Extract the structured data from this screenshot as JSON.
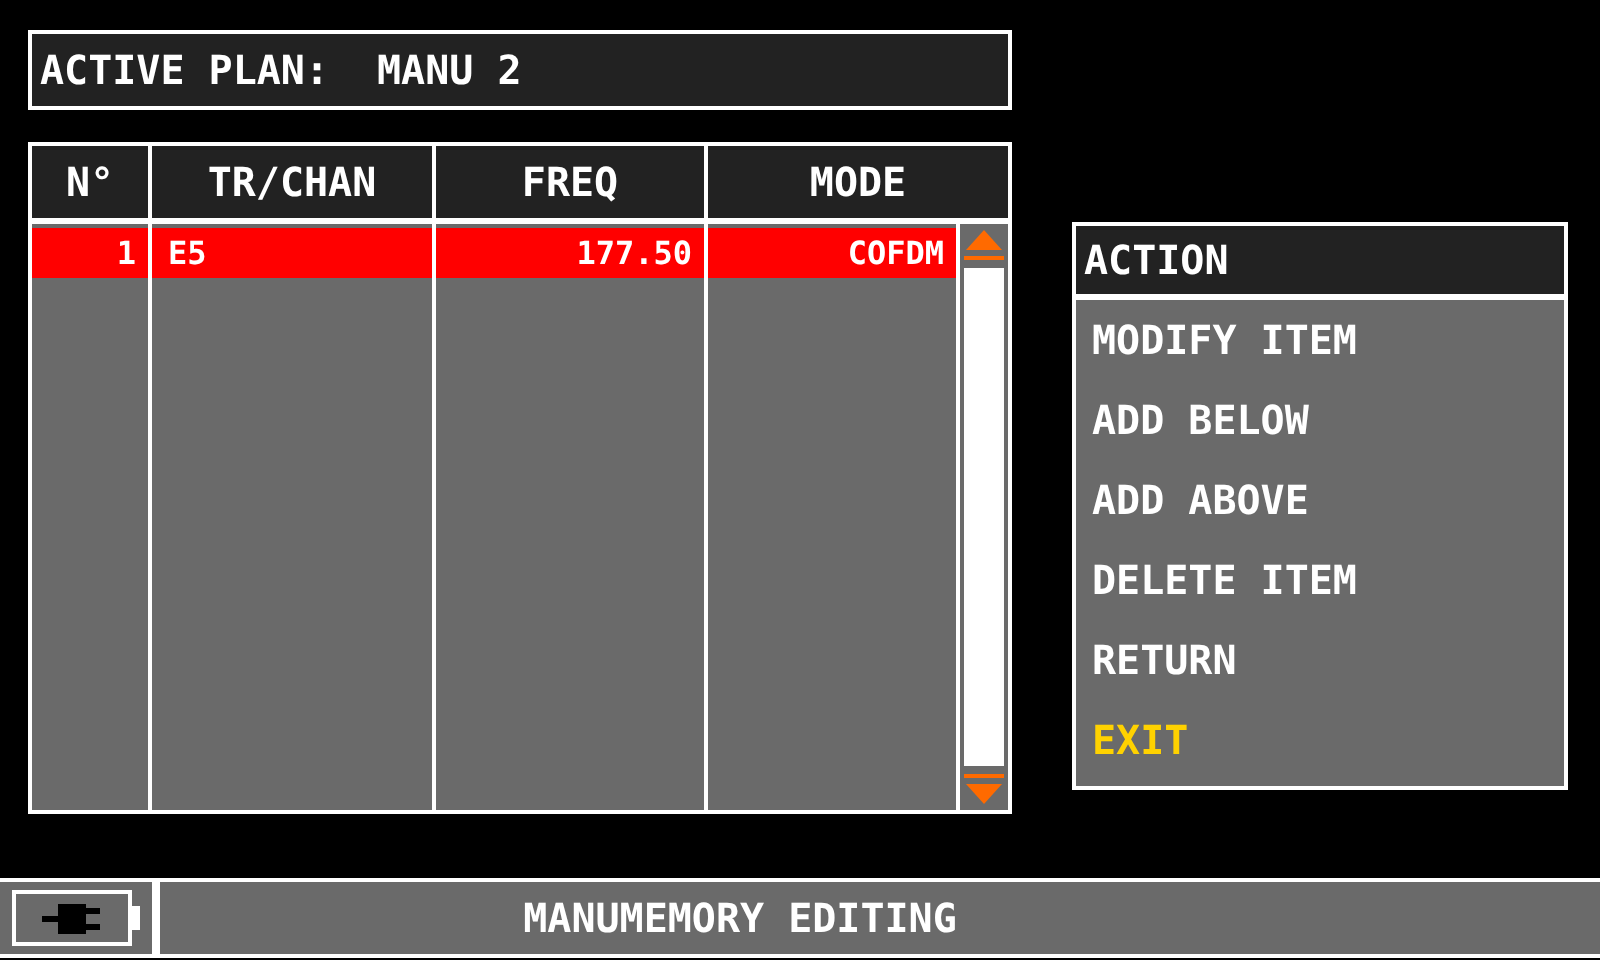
{
  "active_plan": {
    "label": "ACTIVE PLAN:",
    "value": "MANU 2"
  },
  "table": {
    "columns": [
      "N°",
      "TR/CHAN",
      "FREQ",
      "MODE"
    ],
    "rows": [
      {
        "cells": [
          "1",
          "E5",
          "177.50",
          "COFDM"
        ],
        "selected": true
      }
    ]
  },
  "action_menu": {
    "title": "ACTION",
    "items": [
      {
        "label": "MODIFY ITEM",
        "selected": false
      },
      {
        "label": "ADD BELOW",
        "selected": false
      },
      {
        "label": "ADD ABOVE",
        "selected": false
      },
      {
        "label": "DELETE ITEM",
        "selected": false
      },
      {
        "label": "RETURN",
        "selected": false
      },
      {
        "label": "EXIT",
        "selected": true
      }
    ]
  },
  "status_bar": {
    "text": "MANUMEMORY EDITING"
  }
}
